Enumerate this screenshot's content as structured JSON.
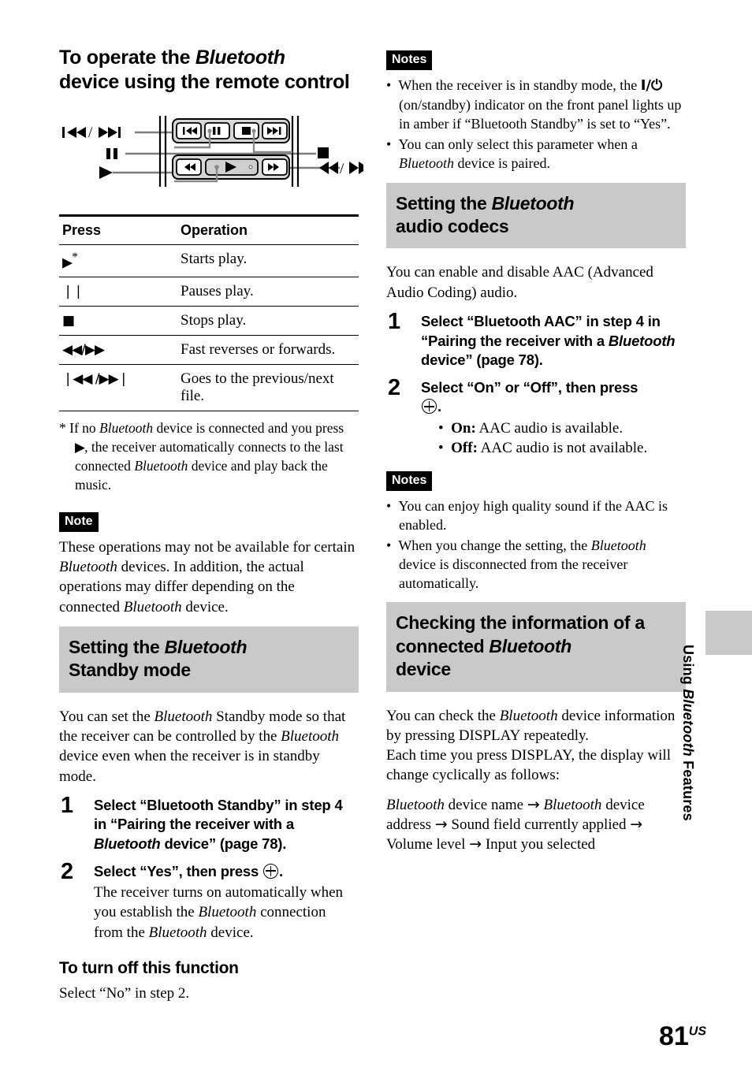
{
  "page": {
    "number": "81",
    "region_suffix": "US",
    "side_tab": {
      "prefix": "Using ",
      "italic": "Bluetooth",
      "suffix": " Features"
    }
  },
  "left_column": {
    "heading": {
      "line1_pre": "To operate the ",
      "line1_italic": "Bluetooth",
      "rest": "device using the remote control"
    },
    "diagram": {
      "name": "remote-control-callout-diagram",
      "callouts": [
        {
          "label": "prev/next",
          "glyph": "❘◀◀ / ▶▶❘",
          "side": "left"
        },
        {
          "label": "pause",
          "glyph": "❘❘",
          "side": "left"
        },
        {
          "label": "play",
          "glyph": "▶",
          "side": "left"
        },
        {
          "label": "stop",
          "glyph": "■",
          "side": "right"
        },
        {
          "label": "fast-reverse/forward",
          "glyph": "◀◀ / ▶▶",
          "side": "right"
        }
      ],
      "buttons_row1": [
        "prev",
        "pause",
        "stop",
        "next"
      ],
      "buttons_row2": [
        "fast-reverse",
        "play",
        "fast-forward"
      ]
    },
    "table": {
      "headers": [
        "Press",
        "Operation"
      ],
      "rows": [
        {
          "key": "▶",
          "key_sup": "*",
          "operation": "Starts play."
        },
        {
          "key": "❘❘",
          "key_sup": "",
          "operation": "Pauses play."
        },
        {
          "key": "■",
          "key_sup": "",
          "operation": "Stops play."
        },
        {
          "key": "◀◀/▶▶",
          "key_sup": "",
          "operation": "Fast reverses or forwards."
        },
        {
          "key": "❘◀◀ /▶▶❘",
          "key_sup": "",
          "operation": "Goes to the previous/next file."
        }
      ]
    },
    "footnote": {
      "marker": "*",
      "part1": "If no ",
      "italic1": "Bluetooth",
      "part2": " device is connected and you press ",
      "glyph": "▶",
      "part3": ", the receiver automatically connects to the last connected ",
      "italic2": "Bluetooth",
      "part4": " device and play back the music."
    },
    "note": {
      "badge": "Note",
      "part1": "These operations may not be available for certain ",
      "italic1": "Bluetooth",
      "part2": " devices. In addition, the actual operations may differ depending on the connected ",
      "italic2": "Bluetooth",
      "part3": " device."
    },
    "standby_section": {
      "band_pre": "Setting the ",
      "band_italic": "Bluetooth",
      "band_post": "Standby mode",
      "intro_part1": "You can set the ",
      "intro_italic1": "Bluetooth",
      "intro_part2": " Standby mode so that the receiver can be controlled by the ",
      "intro_italic2": "Bluetooth",
      "intro_part3": " device even when the receiver is in standby mode.",
      "steps": [
        {
          "num": "1",
          "lead_part1": "Select “Bluetooth Standby” in step 4 in “Pairing the receiver with a ",
          "lead_italic": "Bluetooth",
          "lead_part2": " device” (page 78)."
        },
        {
          "num": "2",
          "lead_part1": "Select “Yes”, then press ",
          "lead_enter": true,
          "lead_part2": ".",
          "cont_part1": "The receiver turns on automatically when you establish the ",
          "cont_italic1": "Bluetooth",
          "cont_part2": " connection from the ",
          "cont_italic2": "Bluetooth",
          "cont_part3": " device."
        }
      ],
      "turn_off_heading": "To turn off this function",
      "turn_off_text": "Select “No” in step 2."
    }
  },
  "right_column": {
    "notes_top": {
      "badge": "Notes",
      "items": [
        {
          "part1": "When the receiver is in standby mode, the ",
          "glyph": "I/⏻",
          "part2": " (on/standby) indicator on the front panel lights up in amber if “Bluetooth Standby” is set to “Yes”."
        },
        {
          "part1": "You can only select this parameter when a ",
          "italic1": "Bluetooth",
          "part2": " device is paired."
        }
      ]
    },
    "codecs_section": {
      "band_pre": "Setting the ",
      "band_italic": "Bluetooth",
      "band_post": "audio codecs",
      "intro": "You can enable and disable AAC (Advanced Audio Coding) audio.",
      "steps": [
        {
          "num": "1",
          "lead_part1": "Select “Bluetooth AAC” in step 4 in “Pairing the receiver with a ",
          "lead_italic": "Bluetooth",
          "lead_part2": " device” (page 78)."
        },
        {
          "num": "2",
          "lead_part1": "Select “On” or “Off”, then press ",
          "lead_enter": true,
          "lead_part2": ".",
          "bullets": [
            {
              "bold": "On:",
              "text": " AAC audio is available."
            },
            {
              "bold": "Off:",
              "text": " AAC audio is not available."
            }
          ]
        }
      ]
    },
    "notes_bottom": {
      "badge": "Notes",
      "items": [
        {
          "part1": "You can enjoy high quality sound if the AAC is enabled."
        },
        {
          "part1": "When you change the setting, the ",
          "italic1": "Bluetooth",
          "part2": " device is disconnected from the receiver automatically."
        }
      ]
    },
    "checking_section": {
      "band_pre": "Checking the information of a connected ",
      "band_italic": "Bluetooth",
      "band_post": "device",
      "intro_part1": "You can check the ",
      "intro_italic1": "Bluetooth",
      "intro_part2": " device information by pressing DISPLAY repeatedly.",
      "intro_part3": "Each time you press DISPLAY, the display will change cyclically as follows:",
      "cycle": {
        "italic_lead": "Bluetooth",
        "items": [
          " device name",
          "device address",
          "Sound field currently applied",
          "Volume level",
          "Input you selected"
        ],
        "separator": "→"
      }
    }
  },
  "colors": {
    "band_gray": "#c9c9c9",
    "text": "#000000",
    "badge_bg": "#000000",
    "badge_fg": "#ffffff"
  }
}
